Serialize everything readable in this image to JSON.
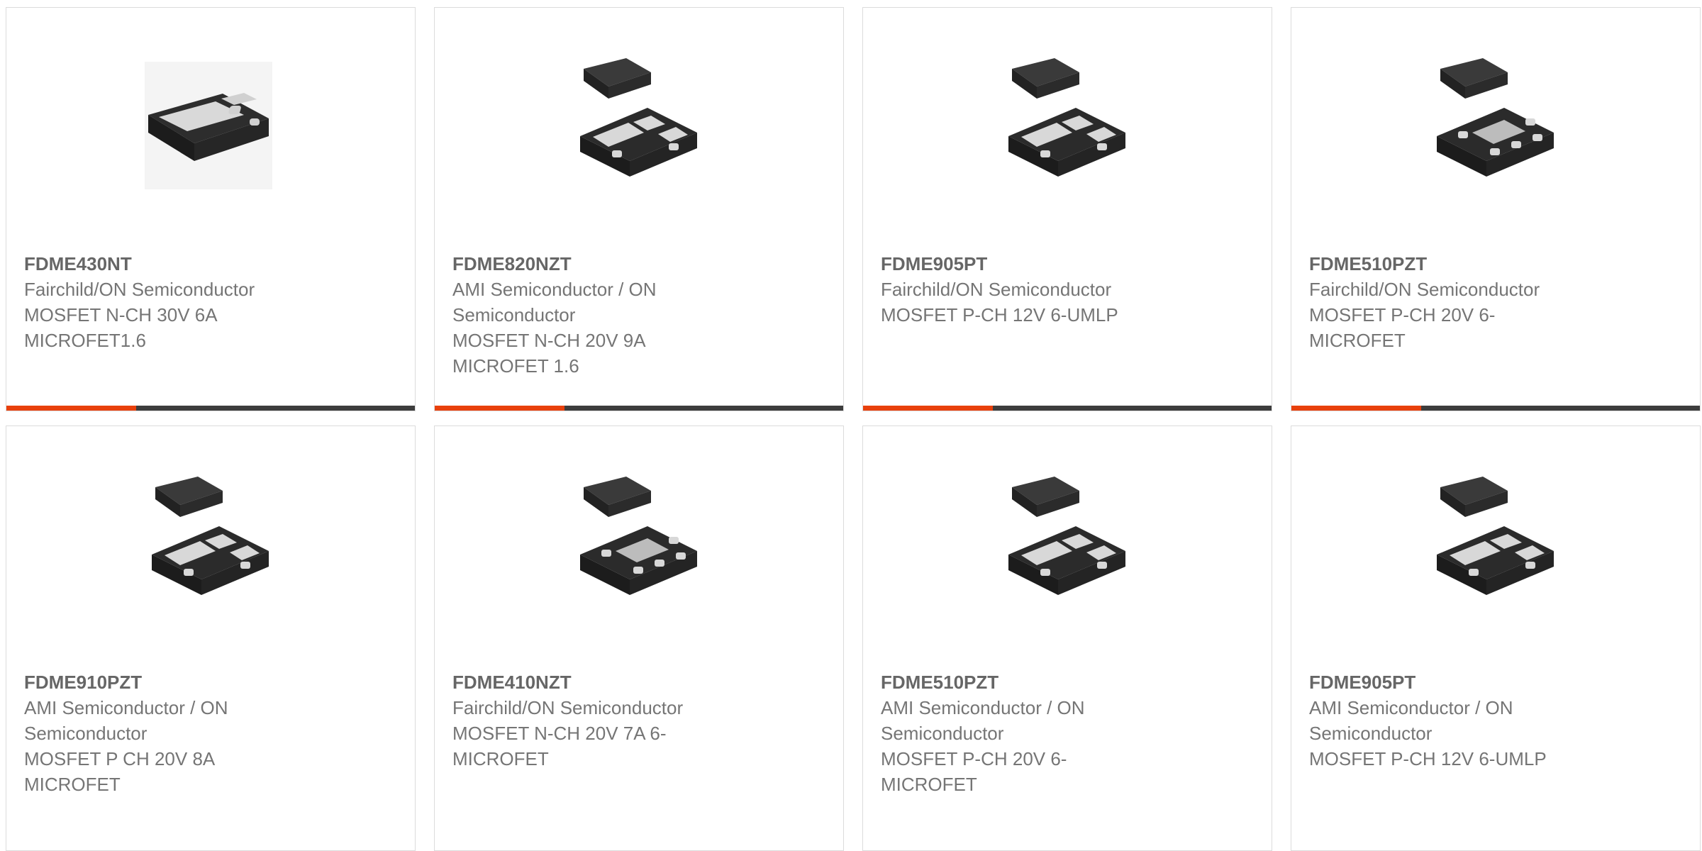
{
  "products": [
    {
      "part_number": "FDME430NT",
      "manufacturer": "Fairchild/ON Semiconductor",
      "description": "MOSFET N-CH 30V 6A MICROFET1.6",
      "image": "dfn6-package-single"
    },
    {
      "part_number": "FDME820NZT",
      "manufacturer": "AMI Semiconductor / ON Semiconductor",
      "description": "MOSFET N-CH 20V 9A MICROFET 1.6",
      "image": "dfn6-package-top-bottom"
    },
    {
      "part_number": "FDME905PT",
      "manufacturer": "Fairchild/ON Semiconductor",
      "description": "MOSFET P-CH 12V 6-UMLP",
      "image": "dfn6-package-top-bottom"
    },
    {
      "part_number": "FDME510PZT",
      "manufacturer": "Fairchild/ON Semiconductor",
      "description": "MOSFET P-CH 20V 6-MICROFET",
      "image": "dfn6-package-top-bottom-center-pad"
    },
    {
      "part_number": "FDME910PZT",
      "manufacturer": "AMI Semiconductor / ON Semiconductor",
      "description": "MOSFET P CH 20V 8A MICROFET",
      "image": "dfn6-package-top-bottom"
    },
    {
      "part_number": "FDME410NZT",
      "manufacturer": "Fairchild/ON Semiconductor",
      "description": "MOSFET N-CH 20V 7A 6-MICROFET",
      "image": "dfn6-package-top-bottom-center-pad"
    },
    {
      "part_number": "FDME510PZT",
      "manufacturer": "AMI Semiconductor / ON Semiconductor",
      "description": "MOSFET P-CH 20V 6-MICROFET",
      "image": "dfn6-package-top-bottom"
    },
    {
      "part_number": "FDME905PT",
      "manufacturer": "AMI Semiconductor / ON Semiconductor",
      "description": "MOSFET P-CH 12V 6-UMLP",
      "image": "dfn6-package-top-bottom"
    }
  ],
  "colors": {
    "accent": "#e8400c",
    "bar": "#3d3d3d",
    "border": "#dcdcdc",
    "text": "#757575"
  }
}
